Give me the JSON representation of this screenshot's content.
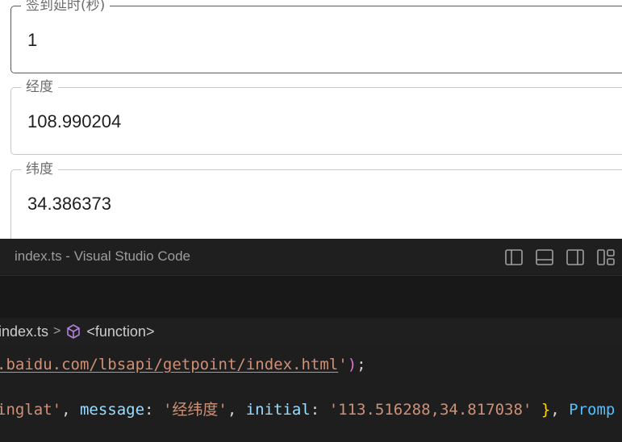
{
  "form": {
    "fields": [
      {
        "label": "签到延时(秒)",
        "value": "1"
      },
      {
        "label": "经度",
        "value": "108.990204"
      },
      {
        "label": "纬度",
        "value": "34.386373"
      }
    ]
  },
  "vscode": {
    "window_title": "index.ts - Visual Studio Code",
    "layout_icons": [
      "toggle-primary-sidebar-icon",
      "toggle-panel-icon",
      "toggle-secondary-sidebar-icon",
      "customize-layout-icon"
    ],
    "breadcrumb": {
      "file": "index.ts",
      "separator": ">",
      "symbol": "<function>"
    },
    "code_lines": {
      "line1": {
        "url": ".baidu.com/lbsapi/getpoint/index.html",
        "quote_end": "'",
        "paren": ")",
        "semi": ";"
      },
      "line2": {
        "str1": "inglat'",
        "comma1": ", ",
        "key_message": "message",
        "colon1": ": ",
        "str_message": "'经纬度'",
        "comma2": ", ",
        "key_initial": "initial",
        "colon2": ": ",
        "str_initial": "'113.516288,34.817038'",
        "space": " ",
        "brace": "}",
        "comma3": ", ",
        "type_prompt": "Promp"
      }
    }
  },
  "colors": {
    "editor_bg": "#1e1e1e",
    "string": "#ce9178",
    "property": "#9cdcfe",
    "bracket_paren": "#da70d6",
    "bracket_brace": "#ffd700",
    "type": "#4fc1ff"
  }
}
